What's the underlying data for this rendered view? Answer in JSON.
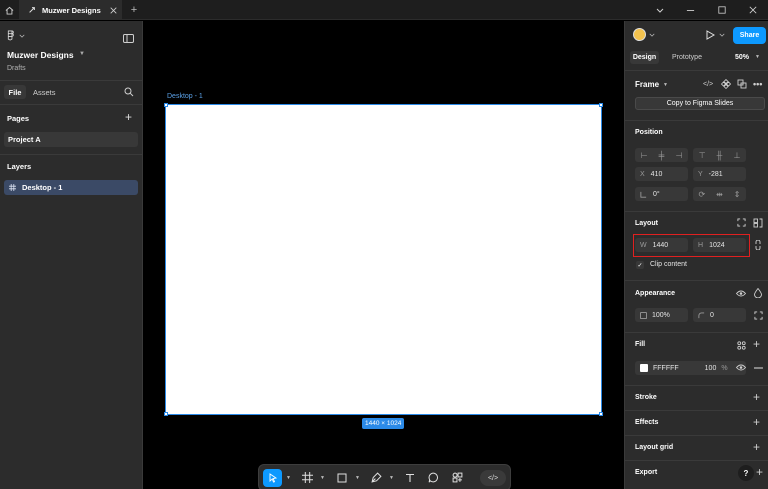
{
  "titlebar": {
    "file_tab_title": "Muzwer Designs"
  },
  "left_panel": {
    "file_name": "Muzwer Designs",
    "location": "Drafts",
    "tabs": {
      "file": "File",
      "assets": "Assets"
    },
    "pages_title": "Pages",
    "pages": [
      "Project A"
    ],
    "layers_title": "Layers",
    "layers": [
      "Desktop - 1"
    ]
  },
  "canvas": {
    "frame_label": "Desktop - 1",
    "frame_size": "1440 × 1024",
    "frame_fill": "#FFFFFF",
    "selection_color": "#2B8AE8"
  },
  "right_panel": {
    "share_label": "Share",
    "tabs": {
      "design": "Design",
      "prototype": "Prototype"
    },
    "zoom": "50%",
    "frame_title": "Frame",
    "copy_slides": "Copy to Figma Slides",
    "position": {
      "title": "Position",
      "x_label": "X",
      "x": "410",
      "y_label": "Y",
      "y": "-281",
      "rotation": "0°"
    },
    "layout": {
      "title": "Layout",
      "w_label": "W",
      "w": "1440",
      "h_label": "H",
      "h": "1024",
      "clip_content": "Clip content"
    },
    "appearance": {
      "title": "Appearance",
      "opacity": "100%",
      "radius": "0"
    },
    "fill": {
      "title": "Fill",
      "hex": "FFFFFF",
      "opacity": "100",
      "unit": "%"
    },
    "stroke_title": "Stroke",
    "effects_title": "Effects",
    "layout_grid_title": "Layout grid",
    "export_title": "Export",
    "help": "?"
  },
  "colors": {
    "accent": "#0D99FF",
    "highlight": "#E02020",
    "panel": "#2C2C2C"
  }
}
